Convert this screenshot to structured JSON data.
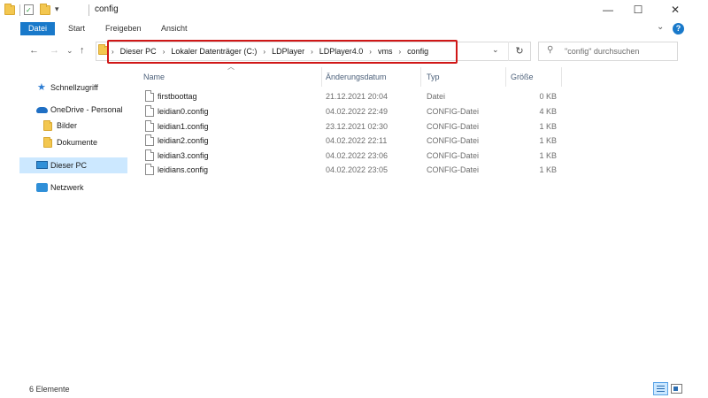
{
  "window": {
    "title": "config",
    "minimize_glyph": "—",
    "maximize_glyph": "☐",
    "close_glyph": "✕"
  },
  "ribbon": {
    "tabs": [
      "Datei",
      "Start",
      "Freigeben",
      "Ansicht"
    ],
    "expand_glyph": "⌄",
    "help_glyph": "?"
  },
  "toolbar": {
    "back_glyph": "←",
    "forward_glyph": "→",
    "recent_glyph": "⌄",
    "up_glyph": "↑"
  },
  "address": {
    "crumbs": [
      "Dieser PC",
      "Lokaler Datenträger (C:)",
      "LDPlayer",
      "LDPlayer4.0",
      "vms",
      "config"
    ],
    "separator": "›",
    "dropdown_glyph": "⌄",
    "refresh_glyph": "↻"
  },
  "search": {
    "placeholder": "\"config\" durchsuchen",
    "icon": "search-icon"
  },
  "nav": {
    "quick_access": "Schnellzugriff",
    "onedrive": "OneDrive - Personal",
    "onedrive_children": [
      "Bilder",
      "Dokumente"
    ],
    "this_pc": "Dieser PC",
    "network": "Netzwerk",
    "selected": "Dieser PC"
  },
  "columns": {
    "name": "Name",
    "modified": "Änderungsdatum",
    "type": "Typ",
    "size": "Größe"
  },
  "files": [
    {
      "name": "firstboottag",
      "modified": "21.12.2021 20:04",
      "type": "Datei",
      "size": "0 KB"
    },
    {
      "name": "leidian0.config",
      "modified": "04.02.2022 22:49",
      "type": "CONFIG-Datei",
      "size": "4 KB"
    },
    {
      "name": "leidian1.config",
      "modified": "23.12.2021 02:30",
      "type": "CONFIG-Datei",
      "size": "1 KB"
    },
    {
      "name": "leidian2.config",
      "modified": "04.02.2022 22:11",
      "type": "CONFIG-Datei",
      "size": "1 KB"
    },
    {
      "name": "leidian3.config",
      "modified": "04.02.2022 23:06",
      "type": "CONFIG-Datei",
      "size": "1 KB"
    },
    {
      "name": "leidians.config",
      "modified": "04.02.2022 23:05",
      "type": "CONFIG-Datei",
      "size": "1 KB"
    }
  ],
  "status": {
    "item_count": "6 Elemente"
  },
  "colors": {
    "accent": "#1979ca",
    "selection": "#cce8ff",
    "highlight_border": "#d01717"
  }
}
